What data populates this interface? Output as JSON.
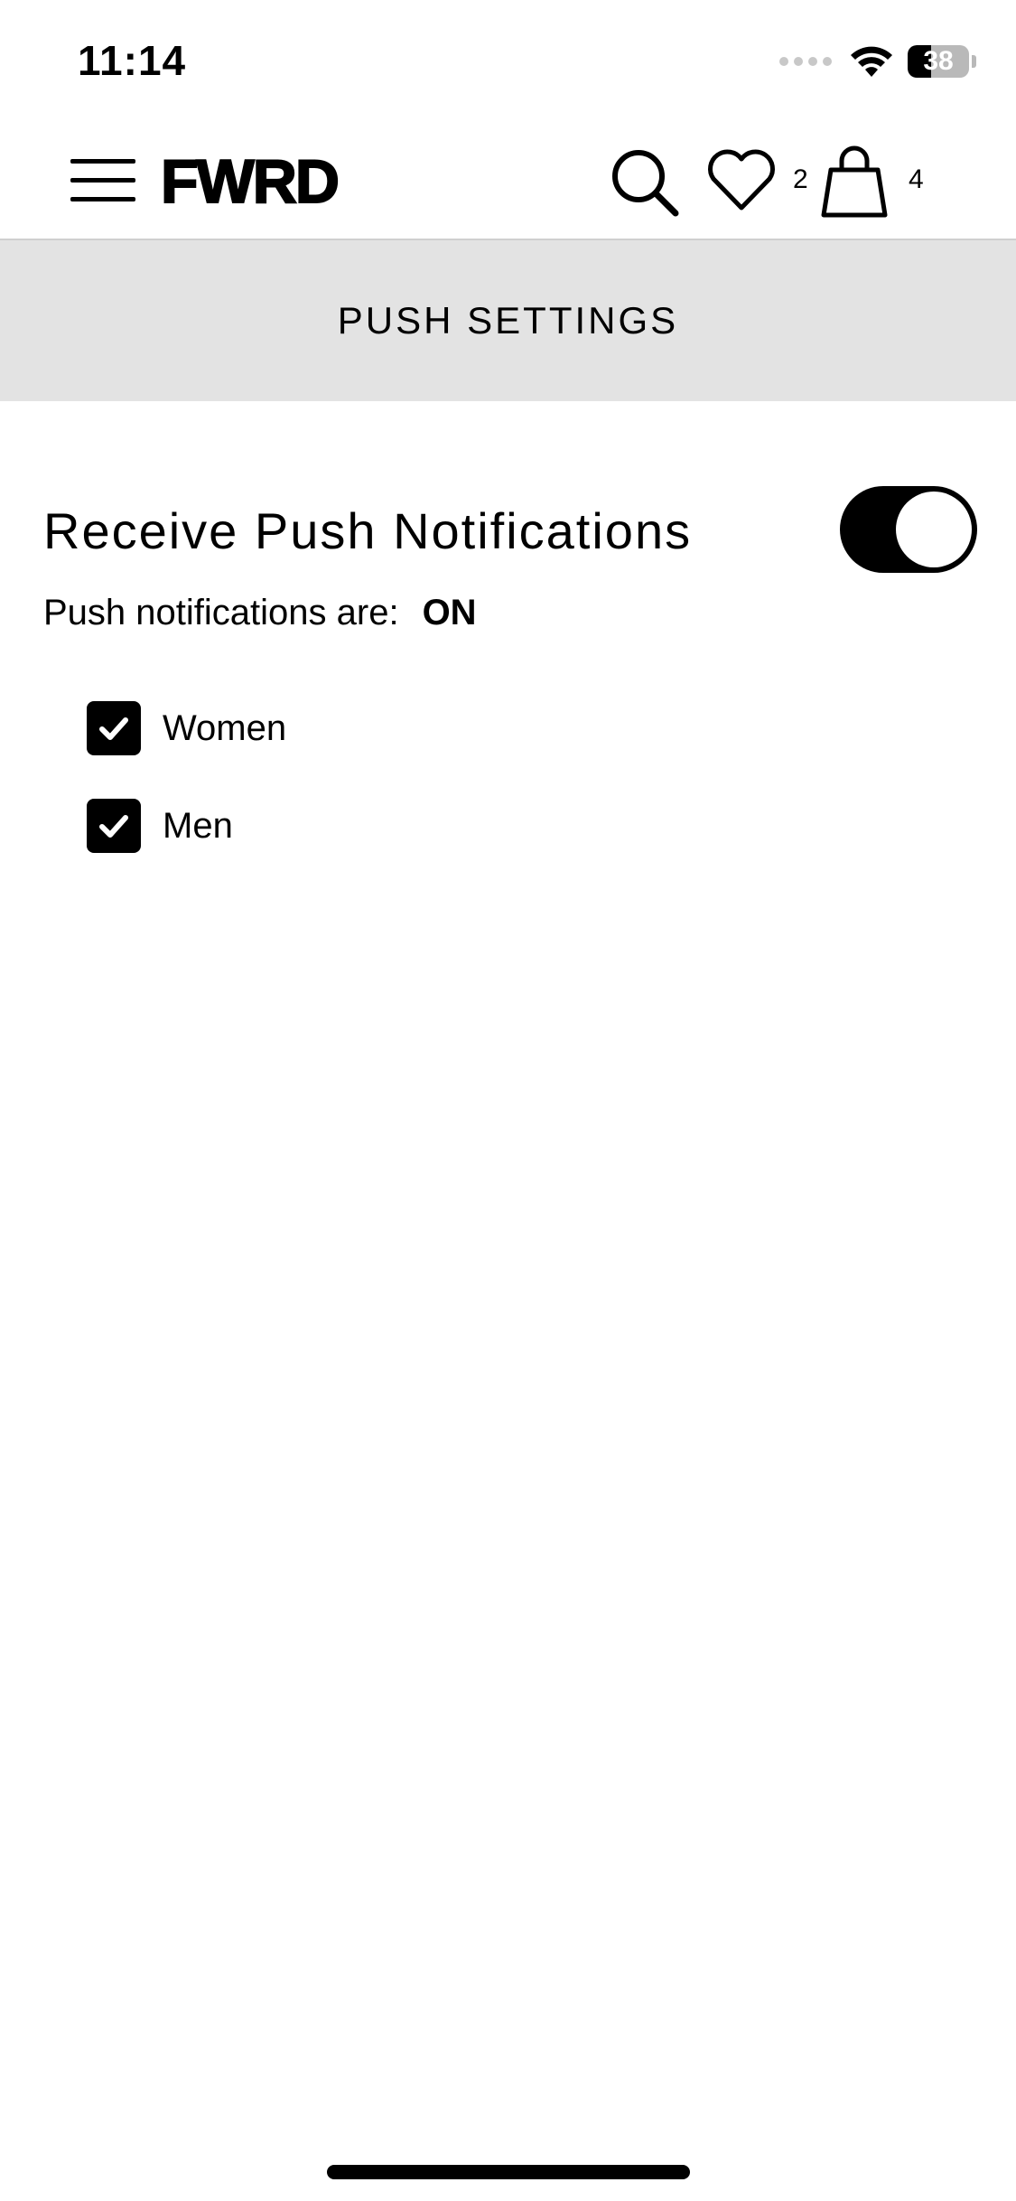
{
  "status_bar": {
    "time": "11:14",
    "battery_level": "38",
    "battery_fraction": 0.38
  },
  "header": {
    "brand": "FWRD",
    "wishlist_count": "2",
    "bag_count": "4",
    "icons": [
      "menu-icon",
      "search-icon",
      "heart-icon",
      "bag-icon"
    ]
  },
  "page": {
    "title": "PUSH SETTINGS"
  },
  "settings": {
    "receive_label": "Receive Push Notifications",
    "toggle_on": true,
    "status_prefix": "Push notifications are:",
    "status_value": "ON",
    "options": [
      {
        "label": "Women",
        "checked": true
      },
      {
        "label": "Men",
        "checked": true
      }
    ]
  },
  "colors": {
    "accent": "#000000",
    "title_band": "#e3e3e3",
    "background": "#ffffff"
  }
}
